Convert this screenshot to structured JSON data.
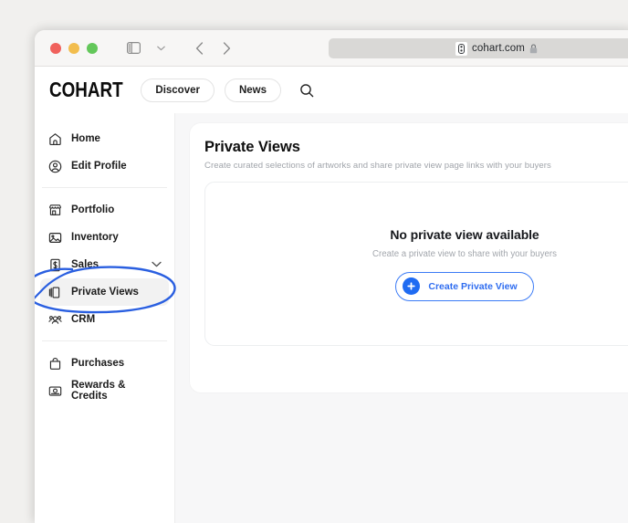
{
  "browser": {
    "traffic_lights": [
      "close",
      "minimize",
      "maximize"
    ],
    "toolbar_icons": [
      "sidebar-toggle-icon",
      "chevron-down-icon",
      "back-arrow-icon",
      "forward-arrow-icon"
    ],
    "address": {
      "url": "cohart.com",
      "shield_icon": "privacy-shield-icon",
      "lock_icon": "lock-icon"
    }
  },
  "site_header": {
    "logo": "COHART",
    "nav": [
      {
        "label": "Discover"
      },
      {
        "label": "News"
      }
    ],
    "search_icon": "search-icon"
  },
  "sidebar": {
    "groups": [
      {
        "items": [
          {
            "label": "Home",
            "icon": "home-icon",
            "active": false
          },
          {
            "label": "Edit Profile",
            "icon": "user-circle-icon",
            "active": false
          }
        ]
      },
      {
        "items": [
          {
            "label": "Portfolio",
            "icon": "storefront-icon",
            "active": false
          },
          {
            "label": "Inventory",
            "icon": "image-icon",
            "active": false
          },
          {
            "label": "Sales",
            "icon": "money-bill-icon",
            "active": false,
            "expandable": true
          },
          {
            "label": "Private Views",
            "icon": "book-open-icon",
            "active": true
          },
          {
            "label": "CRM",
            "icon": "users-group-icon",
            "active": false
          }
        ]
      },
      {
        "items": [
          {
            "label": "Purchases",
            "icon": "shopping-bag-icon",
            "active": false
          },
          {
            "label": "Rewards & Credits",
            "icon": "reward-card-icon",
            "active": false
          }
        ]
      }
    ],
    "annotation": {
      "target": "Private Views",
      "shape": "hand-drawn-ellipse",
      "color": "#2a5fe0"
    }
  },
  "main": {
    "title": "Private Views",
    "subtitle": "Create curated selections of artworks and share private view page links with your buyers",
    "empty_state": {
      "title": "No private view available",
      "subtitle": "Create a private view to share with your buyers",
      "button_label": "Create Private View",
      "button_icon": "plus-circle-icon"
    }
  },
  "colors": {
    "accent_blue": "#1f6bf2",
    "annotation_blue": "#2a5fe0",
    "page_bg": "#f7f7f8",
    "desktop_bg": "#f1f0ee"
  }
}
